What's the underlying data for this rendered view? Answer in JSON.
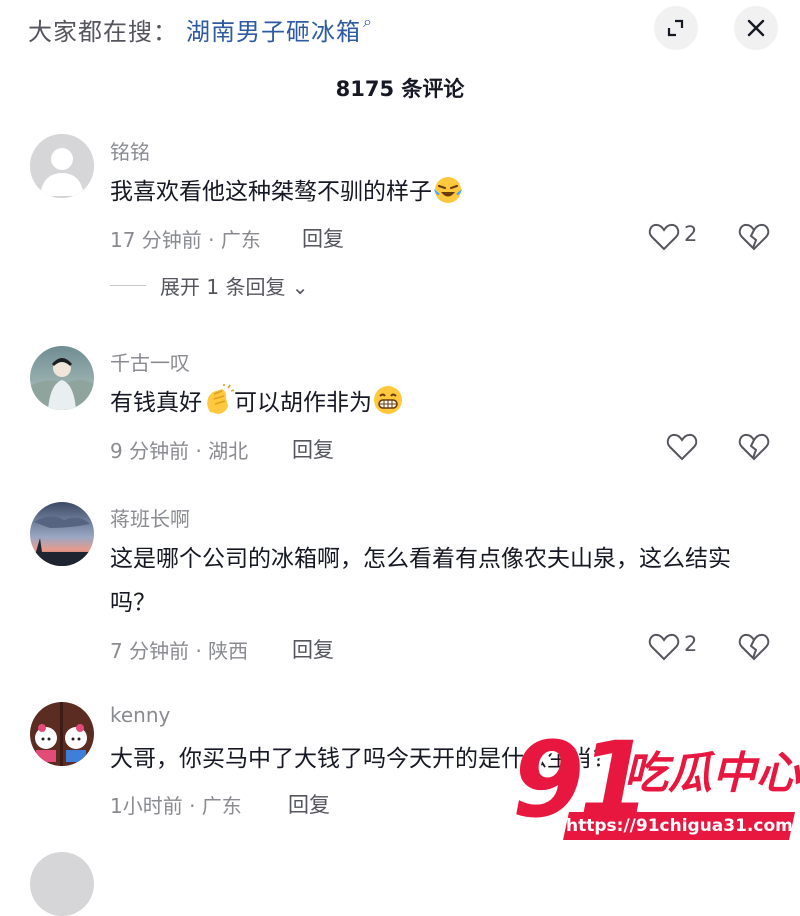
{
  "header": {
    "search_prefix": "大家都在搜：",
    "search_term": "湖南男子砸冰箱",
    "search_glyph": "⌕"
  },
  "comment_count": "8175 条评论",
  "comments": [
    {
      "username": "铭铭",
      "text": "我喜欢看他这种桀骜不驯的样子",
      "emoji_end": "laughing-crying-emoji",
      "meta": "17 分钟前 · 广东",
      "reply_label": "回复",
      "likes": "2",
      "expand_replies": "展开 1 条回复 ⌄"
    },
    {
      "username": "千古一叹",
      "text_part1": "有钱真好",
      "emoji_mid": "clapping-hands-emoji",
      "text_part2": "可以胡作非为",
      "emoji_end": "grinning-emoji",
      "meta": "9 分钟前 · 湖北",
      "reply_label": "回复",
      "likes": ""
    },
    {
      "username": "蒋班长啊",
      "text": "这是哪个公司的冰箱啊，怎么看着有点像农夫山泉，这么结实吗？",
      "meta": "7 分钟前 · 陕西",
      "reply_label": "回复",
      "likes": "2"
    },
    {
      "username": "kenny",
      "text": "大哥，你买马中了大钱了吗今天开的是什么生肖？",
      "meta": "1小时前 · 广东",
      "reply_label": "回复",
      "likes": ""
    }
  ],
  "watermark": {
    "number": "91",
    "title": "吃瓜中心",
    "url": "https://91chigua31.com"
  },
  "colors": {
    "accent_link": "#2d5aa0",
    "text_primary": "#161823",
    "text_secondary": "#8a8b91",
    "watermark_red": "#e8173f"
  }
}
